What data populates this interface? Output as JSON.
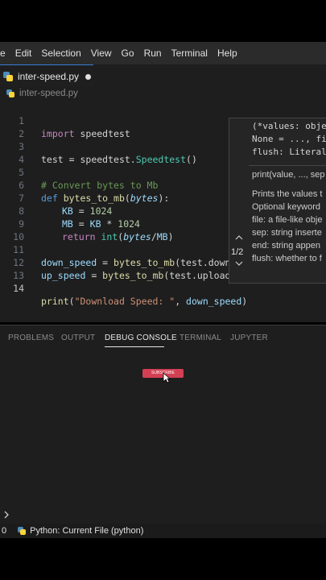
{
  "menubar": {
    "items": [
      "e",
      "Edit",
      "Selection",
      "View",
      "Go",
      "Run",
      "Terminal",
      "Help"
    ]
  },
  "tab": {
    "label": "inter-speed.py"
  },
  "breadcrumb": {
    "label": "inter-speed.py"
  },
  "code": {
    "line_numbers": [
      "1",
      "2",
      "3",
      "4",
      "5",
      "6",
      "7",
      "8",
      "9",
      "10",
      "11",
      "12",
      "13",
      "14"
    ],
    "l1": {
      "kw": "import",
      "mod": " speedtest"
    },
    "l3": {
      "var": "test",
      "eq": " = speedtest.",
      "cls": "Speedtest",
      "end": "()"
    },
    "l5": {
      "comment": "# Convert bytes to Mb"
    },
    "l6": {
      "kw": "def",
      "fn": " bytes_to_mb",
      "open": "(",
      "param": "bytes",
      "close": "):"
    },
    "l7": {
      "var": "KB",
      "eq": " = ",
      "num": "1024"
    },
    "l8": {
      "var": "MB",
      "eq": " = ",
      "var2": "KB",
      "op": " * ",
      "num": "1024"
    },
    "l9": {
      "kw": "return",
      "fn": " int",
      "open": "(",
      "param": "bytes",
      "op": "/",
      "var": "MB",
      "close": ")"
    },
    "l11": {
      "var": "down_speed",
      "eq": " = ",
      "fn": "bytes_to_mb",
      "rest": "(test.downlo"
    },
    "l12": {
      "var": "up_speed",
      "eq": " = ",
      "fn": "bytes_to_mb",
      "rest": "(test.upload()"
    },
    "l14": {
      "fn": "print",
      "open": "(",
      "str": "\"Download Speed: \"",
      "sep": ", ",
      "var": "down_speed",
      "close": ")"
    }
  },
  "signature_popup": {
    "sig1": "(*values: obje",
    "sig2": "None = ..., fi",
    "sig3": "flush: Literal",
    "doc1": "print(value, ..., sep",
    "doc2": "Prints the values t",
    "doc3": "Optional keyword",
    "doc4": "file: a file-like obje",
    "doc5": "sep: string inserte",
    "doc6": "end: string appen",
    "doc7": "flush: whether to f",
    "counter": "1/2",
    "up_icon": "chevron-up-icon",
    "down_icon": "chevron-down-icon"
  },
  "panel": {
    "tabs": [
      "PROBLEMS",
      "OUTPUT",
      "DEBUG CONSOLE",
      "TERMINAL",
      "JUPYTER"
    ],
    "active_tab": "DEBUG CONSOLE",
    "prompt_icon": "chevron-right-icon"
  },
  "overlay": {
    "subscribe_label": "SUBSCRIBE"
  },
  "statusbar": {
    "left": "0",
    "interpreter": "Python: Current File (python)"
  },
  "colors": {
    "accent": "#3a7bd5",
    "subscribe": "#d33f53",
    "editor_bg": "#1e1e1e"
  }
}
